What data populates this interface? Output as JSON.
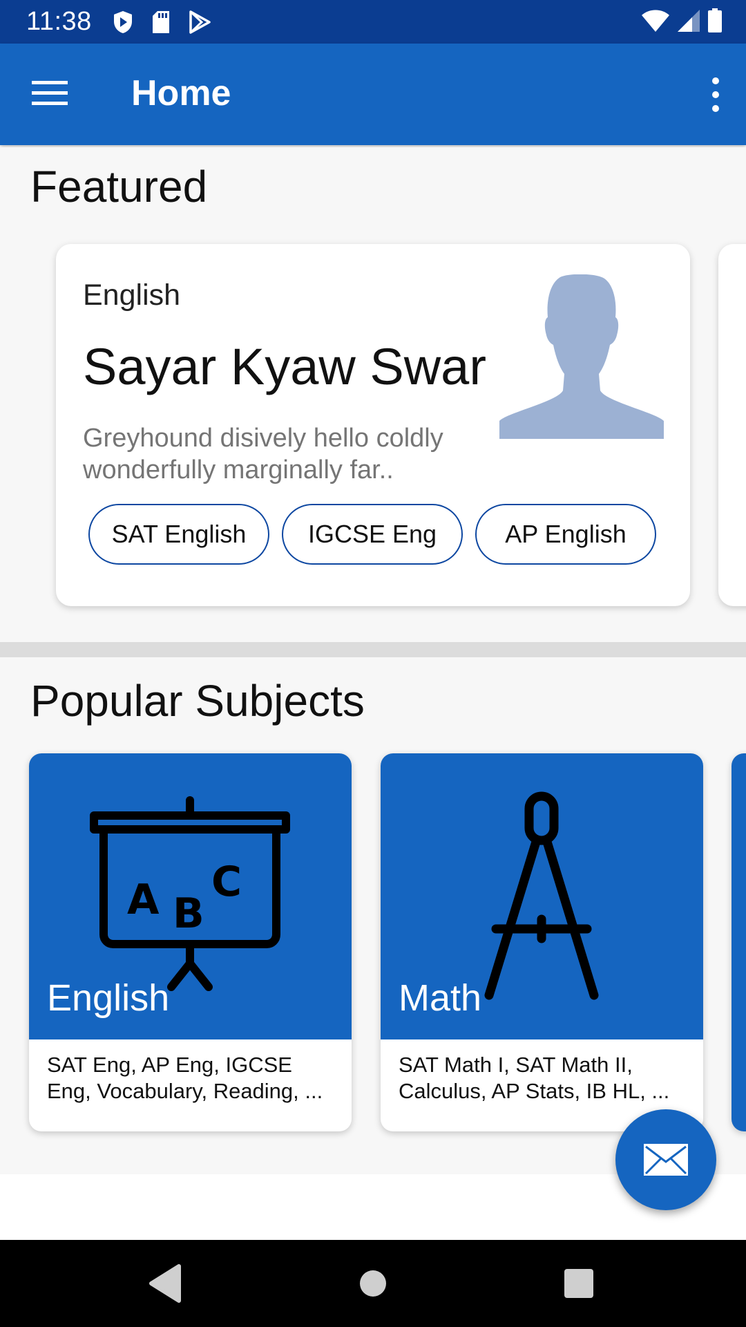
{
  "status_bar": {
    "time": "11:38",
    "left_icons": [
      "shield-icon",
      "sd-card-icon",
      "play-store-icon"
    ],
    "right_icons": [
      "wifi-icon",
      "signal-icon",
      "battery-icon"
    ]
  },
  "app_bar": {
    "title": "Home",
    "menu_icon": "menu-icon",
    "overflow_icon": "more-vert-icon"
  },
  "featured": {
    "section_title": "Featured",
    "card": {
      "subject": "English",
      "tutor_name": "Sayar Kyaw Swar",
      "description": "Greyhound disively hello coldly wonderfully marginally far..",
      "avatar_icon": "person-silhouette-icon",
      "chips": [
        "SAT English",
        "IGCSE Eng",
        "AP English"
      ]
    }
  },
  "popular": {
    "section_title": "Popular Subjects",
    "subjects": [
      {
        "name": "English",
        "topics": "SAT Eng, AP Eng, IGCSE Eng, Vocabulary, Reading, ...",
        "icon": "abc-board-icon"
      },
      {
        "name": "Math",
        "topics": "SAT Math I, SAT Math II, Calculus, AP Stats, IB HL, ...",
        "icon": "compass-icon"
      }
    ]
  },
  "fab": {
    "icon": "mail-icon"
  },
  "nav_bar": {
    "icons": [
      "back-icon",
      "home-icon",
      "recents-icon"
    ]
  },
  "colors": {
    "status_bar": "#0b3d91",
    "primary": "#1565c0",
    "chip_border": "#0d47a1",
    "background": "#f7f7f7",
    "description_text": "#757575"
  }
}
